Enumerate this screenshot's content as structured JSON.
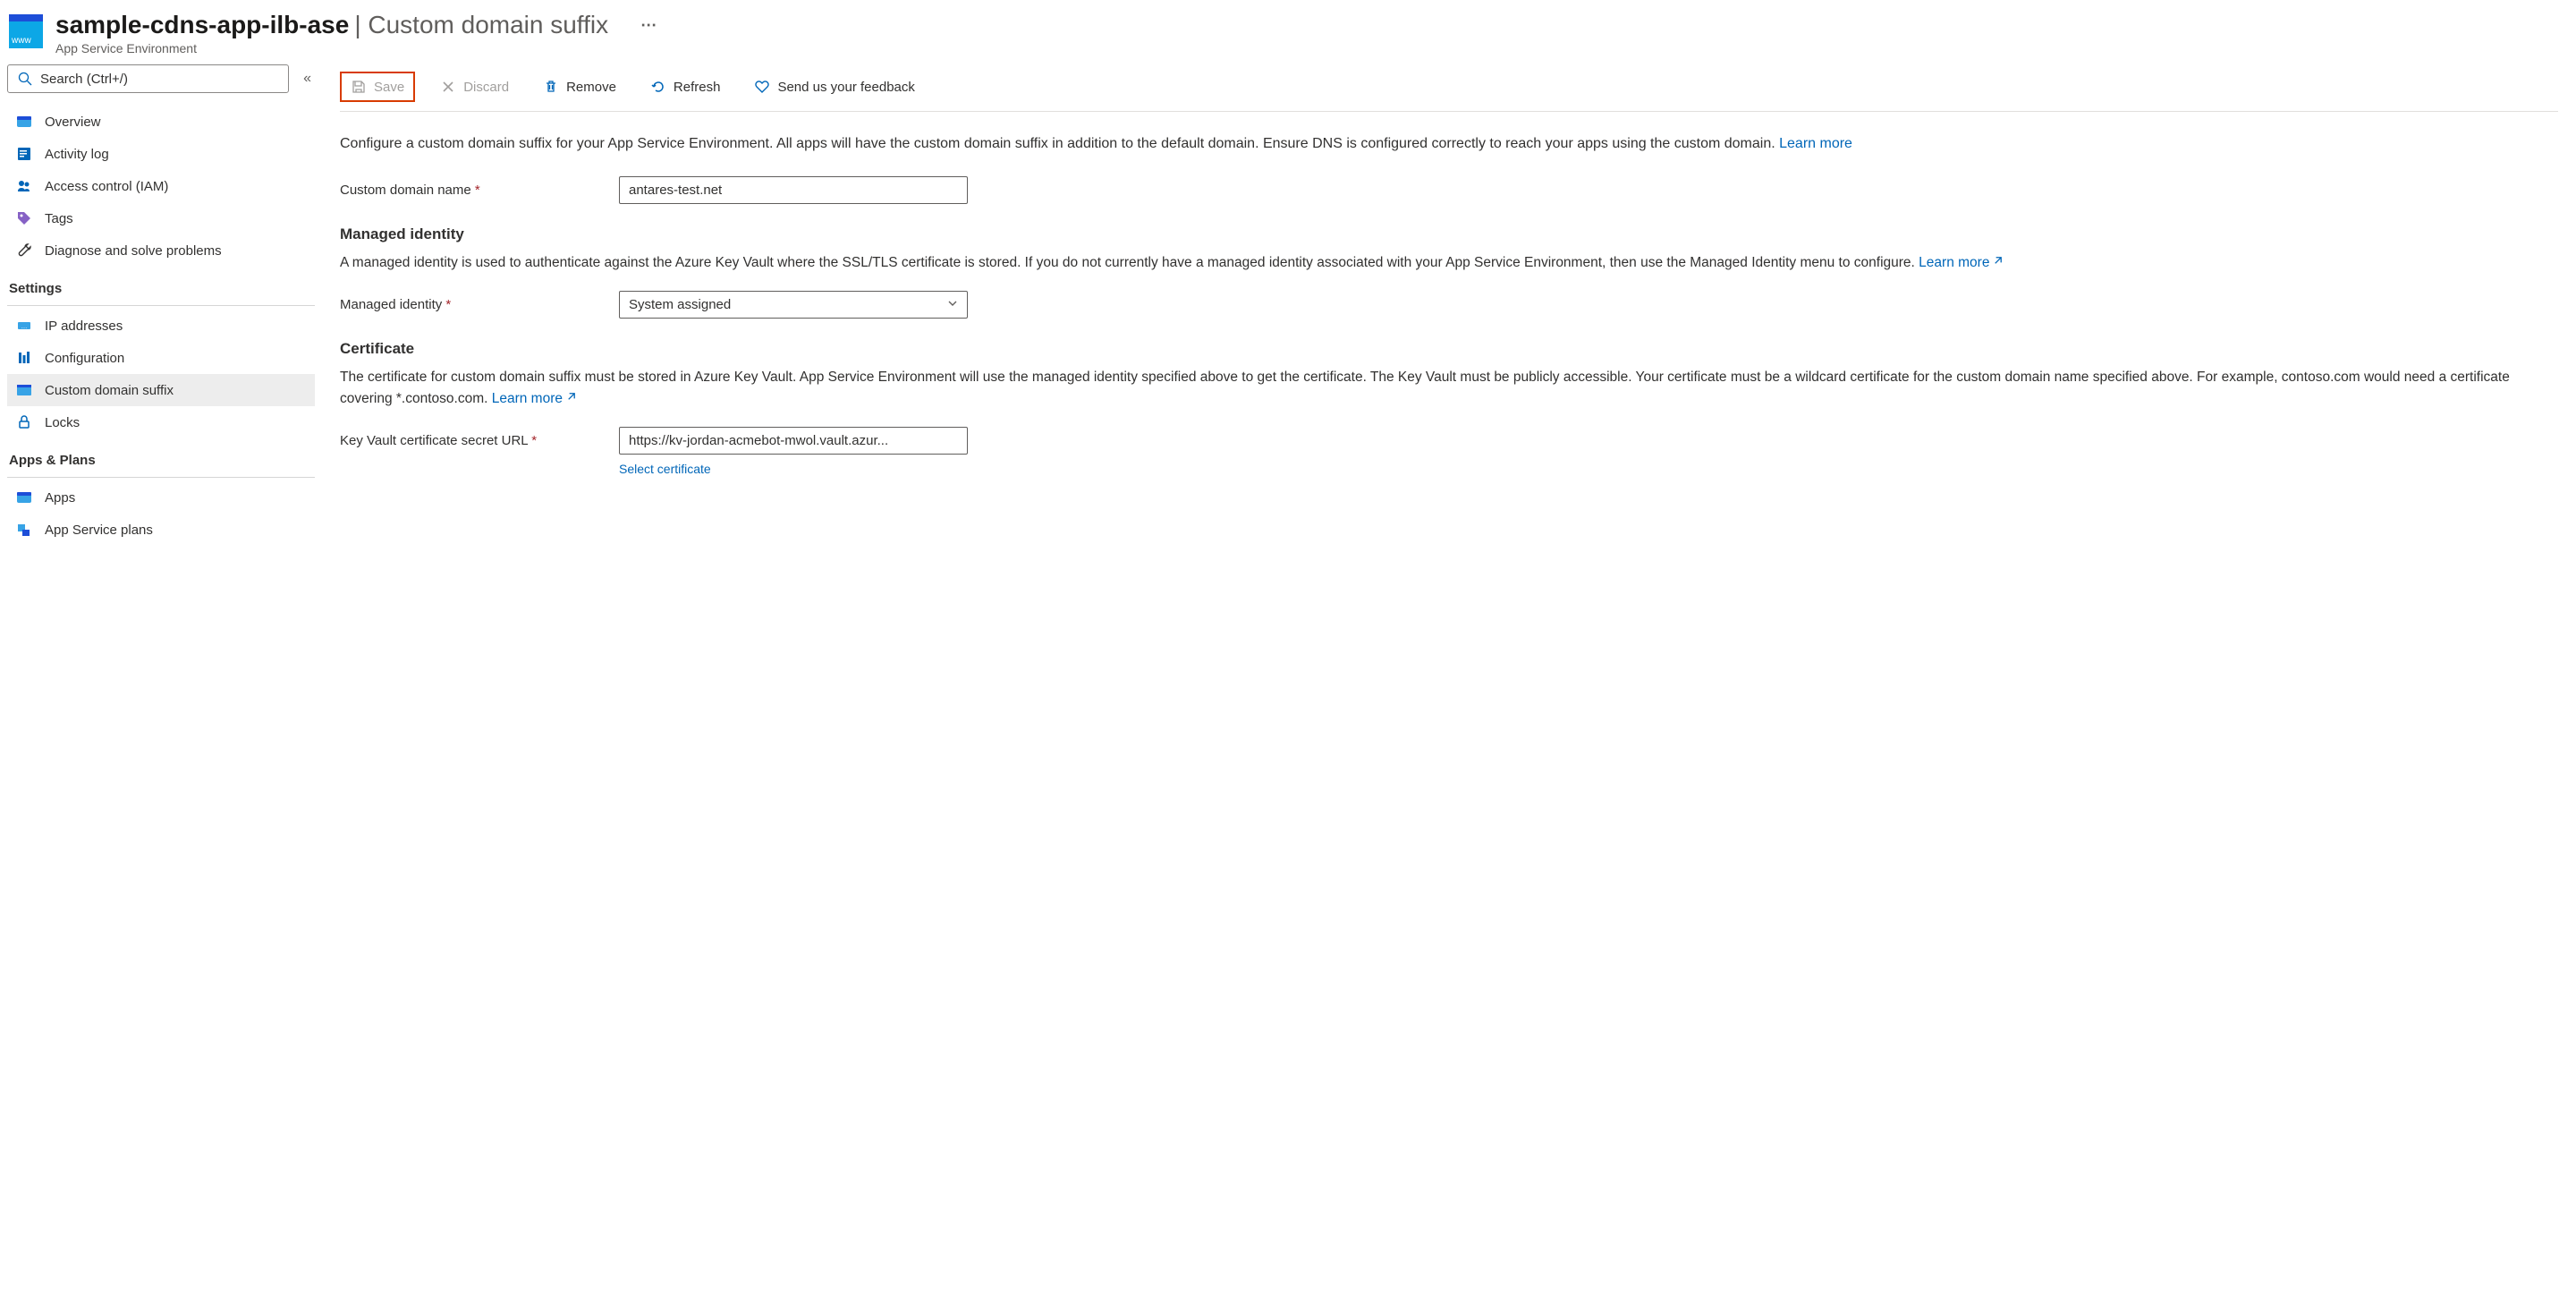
{
  "header": {
    "resource_name": "sample-cdns-app-ilb-ase",
    "page_title": "Custom domain suffix",
    "resource_type": "App Service Environment",
    "icon_label": "www"
  },
  "search": {
    "placeholder": "Search (Ctrl+/)"
  },
  "nav": {
    "items_top": [
      {
        "label": "Overview",
        "icon": "globe"
      },
      {
        "label": "Activity log",
        "icon": "log"
      },
      {
        "label": "Access control (IAM)",
        "icon": "people"
      },
      {
        "label": "Tags",
        "icon": "tag"
      },
      {
        "label": "Diagnose and solve problems",
        "icon": "wrench"
      }
    ],
    "section_settings": "Settings",
    "items_settings": [
      {
        "label": "IP addresses",
        "icon": "ip"
      },
      {
        "label": "Configuration",
        "icon": "config"
      },
      {
        "label": "Custom domain suffix",
        "icon": "domain",
        "active": true
      },
      {
        "label": "Locks",
        "icon": "lock"
      }
    ],
    "section_apps": "Apps & Plans",
    "items_apps": [
      {
        "label": "Apps",
        "icon": "apps"
      },
      {
        "label": "App Service plans",
        "icon": "plans"
      }
    ]
  },
  "toolbar": {
    "save": "Save",
    "discard": "Discard",
    "remove": "Remove",
    "refresh": "Refresh",
    "feedback": "Send us your feedback"
  },
  "content": {
    "intro": "Configure a custom domain suffix for your App Service Environment. All apps will have the custom domain suffix in addition to the default domain. Ensure DNS is configured correctly to reach your apps using the custom domain. ",
    "learn_more": "Learn more",
    "custom_domain_label": "Custom domain name",
    "custom_domain_value": "antares-test.net",
    "managed_identity_heading": "Managed identity",
    "managed_identity_desc": "A managed identity is used to authenticate against the Azure Key Vault where the SSL/TLS certificate is stored. If you do not currently have a managed identity associated with your App Service Environment, then use the Managed Identity menu to configure. ",
    "managed_identity_label": "Managed identity",
    "managed_identity_value": "System assigned",
    "certificate_heading": "Certificate",
    "certificate_desc": "The certificate for custom domain suffix must be stored in Azure Key Vault. App Service Environment will use the managed identity specified above to get the certificate. The Key Vault must be publicly accessible. Your certificate must be a wildcard certificate for the custom domain name specified above. For example, contoso.com would need a certificate covering *.contoso.com. ",
    "keyvault_url_label": "Key Vault certificate secret URL",
    "keyvault_url_value": "https://kv-jordan-acmebot-mwol.vault.azur...",
    "select_certificate": "Select certificate"
  }
}
